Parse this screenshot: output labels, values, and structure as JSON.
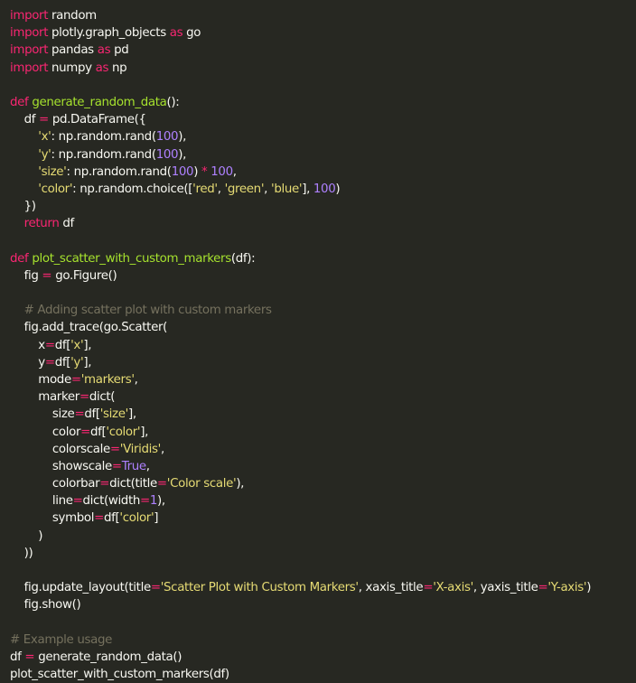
{
  "editor": {
    "background": "#272822",
    "colors": {
      "keyword": "#f92672",
      "function": "#a6e22e",
      "string": "#e6db74",
      "number": "#ae81ff",
      "comment": "#75715e",
      "text": "#f8f8f2"
    },
    "lines": [
      [
        [
          "kw",
          "import"
        ],
        [
          "plain",
          " random"
        ]
      ],
      [
        [
          "kw",
          "import"
        ],
        [
          "plain",
          " plotly.graph_objects "
        ],
        [
          "kw",
          "as"
        ],
        [
          "plain",
          " go"
        ]
      ],
      [
        [
          "kw",
          "import"
        ],
        [
          "plain",
          " pandas "
        ],
        [
          "kw",
          "as"
        ],
        [
          "plain",
          " pd"
        ]
      ],
      [
        [
          "kw",
          "import"
        ],
        [
          "plain",
          " numpy "
        ],
        [
          "kw",
          "as"
        ],
        [
          "plain",
          " np"
        ]
      ],
      [],
      [
        [
          "kw",
          "def"
        ],
        [
          "plain",
          " "
        ],
        [
          "fn",
          "generate_random_data"
        ],
        [
          "plain",
          "():"
        ]
      ],
      [
        [
          "plain",
          "    df "
        ],
        [
          "kw",
          "="
        ],
        [
          "plain",
          " pd.DataFrame({"
        ]
      ],
      [
        [
          "plain",
          "        "
        ],
        [
          "str",
          "'x'"
        ],
        [
          "plain",
          ": np.random.rand("
        ],
        [
          "num",
          "100"
        ],
        [
          "plain",
          "),"
        ]
      ],
      [
        [
          "plain",
          "        "
        ],
        [
          "str",
          "'y'"
        ],
        [
          "plain",
          ": np.random.rand("
        ],
        [
          "num",
          "100"
        ],
        [
          "plain",
          "),"
        ]
      ],
      [
        [
          "plain",
          "        "
        ],
        [
          "str",
          "'size'"
        ],
        [
          "plain",
          ": np.random.rand("
        ],
        [
          "num",
          "100"
        ],
        [
          "plain",
          ") "
        ],
        [
          "kw",
          "*"
        ],
        [
          "plain",
          " "
        ],
        [
          "num",
          "100"
        ],
        [
          "plain",
          ","
        ]
      ],
      [
        [
          "plain",
          "        "
        ],
        [
          "str",
          "'color'"
        ],
        [
          "plain",
          ": np.random.choice(["
        ],
        [
          "str",
          "'red'"
        ],
        [
          "plain",
          ", "
        ],
        [
          "str",
          "'green'"
        ],
        [
          "plain",
          ", "
        ],
        [
          "str",
          "'blue'"
        ],
        [
          "plain",
          "], "
        ],
        [
          "num",
          "100"
        ],
        [
          "plain",
          ")"
        ]
      ],
      [
        [
          "plain",
          "    })"
        ]
      ],
      [
        [
          "plain",
          "    "
        ],
        [
          "kw",
          "return"
        ],
        [
          "plain",
          " df"
        ]
      ],
      [],
      [
        [
          "kw",
          "def"
        ],
        [
          "plain",
          " "
        ],
        [
          "fn",
          "plot_scatter_with_custom_markers"
        ],
        [
          "plain",
          "(df):"
        ]
      ],
      [
        [
          "plain",
          "    fig "
        ],
        [
          "kw",
          "="
        ],
        [
          "plain",
          " go.Figure()"
        ]
      ],
      [],
      [
        [
          "plain",
          "    "
        ],
        [
          "cm",
          "# Adding scatter plot with custom markers"
        ]
      ],
      [
        [
          "plain",
          "    fig.add_trace(go.Scatter("
        ]
      ],
      [
        [
          "plain",
          "        x"
        ],
        [
          "kw",
          "="
        ],
        [
          "plain",
          "df["
        ],
        [
          "str",
          "'x'"
        ],
        [
          "plain",
          "],"
        ]
      ],
      [
        [
          "plain",
          "        y"
        ],
        [
          "kw",
          "="
        ],
        [
          "plain",
          "df["
        ],
        [
          "str",
          "'y'"
        ],
        [
          "plain",
          "],"
        ]
      ],
      [
        [
          "plain",
          "        mode"
        ],
        [
          "kw",
          "="
        ],
        [
          "str",
          "'markers'"
        ],
        [
          "plain",
          ","
        ]
      ],
      [
        [
          "plain",
          "        marker"
        ],
        [
          "kw",
          "="
        ],
        [
          "plain",
          "dict("
        ]
      ],
      [
        [
          "plain",
          "            size"
        ],
        [
          "kw",
          "="
        ],
        [
          "plain",
          "df["
        ],
        [
          "str",
          "'size'"
        ],
        [
          "plain",
          "],"
        ]
      ],
      [
        [
          "plain",
          "            color"
        ],
        [
          "kw",
          "="
        ],
        [
          "plain",
          "df["
        ],
        [
          "str",
          "'color'"
        ],
        [
          "plain",
          "],"
        ]
      ],
      [
        [
          "plain",
          "            colorscale"
        ],
        [
          "kw",
          "="
        ],
        [
          "str",
          "'Viridis'"
        ],
        [
          "plain",
          ","
        ]
      ],
      [
        [
          "plain",
          "            showscale"
        ],
        [
          "kw",
          "="
        ],
        [
          "const",
          "True"
        ],
        [
          "plain",
          ","
        ]
      ],
      [
        [
          "plain",
          "            colorbar"
        ],
        [
          "kw",
          "="
        ],
        [
          "plain",
          "dict(title"
        ],
        [
          "kw",
          "="
        ],
        [
          "str",
          "'Color scale'"
        ],
        [
          "plain",
          "),"
        ]
      ],
      [
        [
          "plain",
          "            line"
        ],
        [
          "kw",
          "="
        ],
        [
          "plain",
          "dict(width"
        ],
        [
          "kw",
          "="
        ],
        [
          "num",
          "1"
        ],
        [
          "plain",
          "),"
        ]
      ],
      [
        [
          "plain",
          "            symbol"
        ],
        [
          "kw",
          "="
        ],
        [
          "plain",
          "df["
        ],
        [
          "str",
          "'color'"
        ],
        [
          "plain",
          "]"
        ]
      ],
      [
        [
          "plain",
          "        )"
        ]
      ],
      [
        [
          "plain",
          "    ))"
        ]
      ],
      [],
      [
        [
          "plain",
          "    fig.update_layout(title"
        ],
        [
          "kw",
          "="
        ],
        [
          "str",
          "'Scatter Plot with Custom Markers'"
        ],
        [
          "plain",
          ", xaxis_title"
        ],
        [
          "kw",
          "="
        ],
        [
          "str",
          "'X-axis'"
        ],
        [
          "plain",
          ", yaxis_title"
        ],
        [
          "kw",
          "="
        ],
        [
          "str",
          "'Y-axis'"
        ],
        [
          "plain",
          ")"
        ]
      ],
      [
        [
          "plain",
          "    fig.show()"
        ]
      ],
      [],
      [
        [
          "cm",
          "# Example usage"
        ]
      ],
      [
        [
          "plain",
          "df "
        ],
        [
          "kw",
          "="
        ],
        [
          "plain",
          " generate_random_data()"
        ]
      ],
      [
        [
          "plain",
          "plot_scatter_with_custom_markers(df)"
        ]
      ]
    ]
  }
}
